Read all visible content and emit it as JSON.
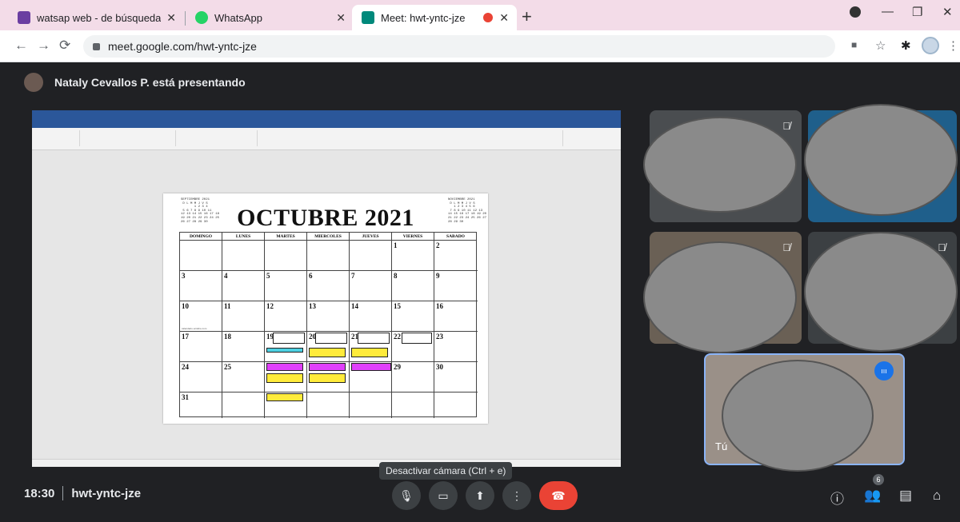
{
  "browser": {
    "tabs": [
      {
        "title": "watsap web - de búsqueda",
        "color": "#6a3ea1"
      },
      {
        "title": "WhatsApp",
        "color": "#25d366"
      },
      {
        "title": "Meet: hwt-yntc-jze",
        "color": "#00897b"
      }
    ],
    "url": "meet.google.com/hwt-yntc-jze"
  },
  "meet": {
    "presenting_text": "Nataly Cevallos P. está presentando",
    "time": "18:30",
    "code": "hwt-yntc-jze",
    "tooltip": "Desactivar cámara (Ctrl + e)",
    "self_label": "Tú",
    "participant_count": "6",
    "end_call_color": "#ea4335"
  },
  "document": {
    "calendar_title": "OCTUBRE 2021",
    "mini_left_title": "SEPTIEMBRE 2021",
    "mini_right_title": "NOVIEMBRE 2021",
    "weekdays": [
      "DOMINGO",
      "LUNES",
      "MARTES",
      "MIERCOLES",
      "JUEVES",
      "VIERNES",
      "SABADO"
    ],
    "watermark": "calendario-octubre.com"
  }
}
